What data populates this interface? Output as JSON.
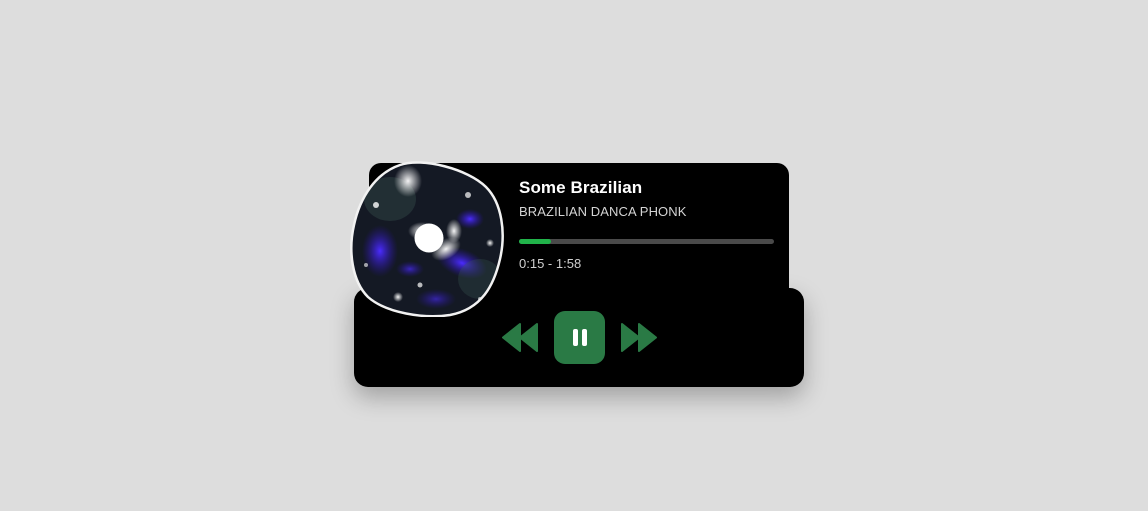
{
  "player": {
    "title": "Some Brazilian",
    "artist": "BRAZILIAN DANCA PHONK",
    "elapsed": "0:15",
    "separator": " - ",
    "duration": "1:58",
    "progress_fraction": 0.127
  },
  "controls": {
    "rewind_icon": "rewind-icon",
    "pause_icon": "pause-icon",
    "forward_icon": "fast-forward-icon"
  },
  "colors": {
    "background": "#dddddd",
    "card": "#000000",
    "accent_green": "#21b34a",
    "button_green": "#2a7a45",
    "album_purple": "#3a1fd6"
  }
}
